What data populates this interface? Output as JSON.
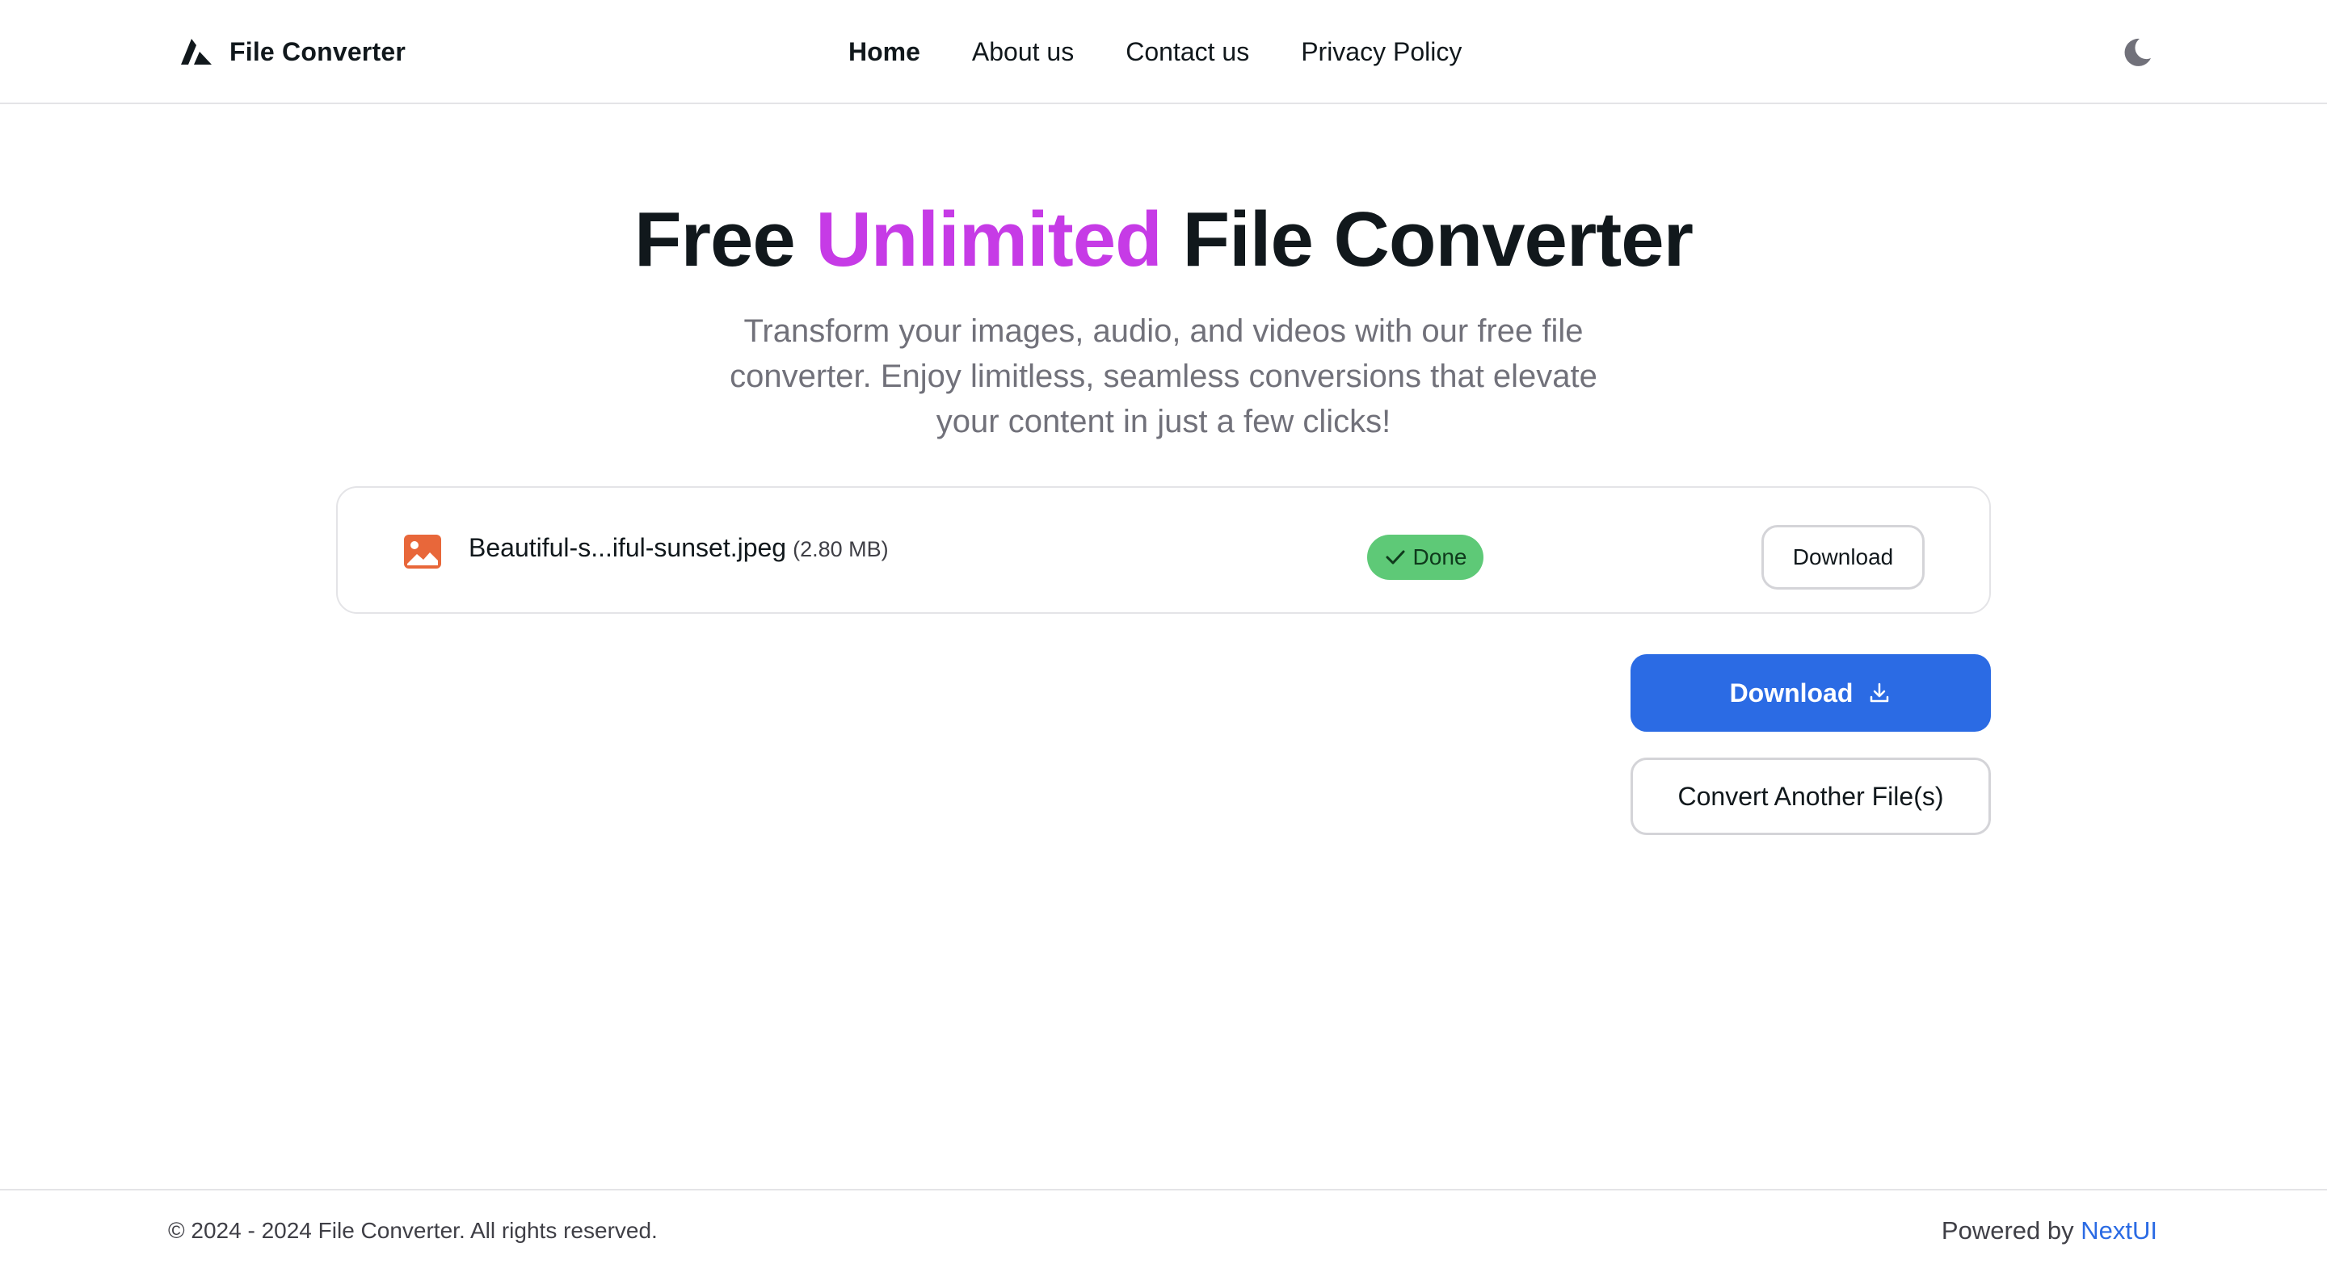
{
  "navbar": {
    "brand": {
      "name": "File Converter",
      "logo_icon": "triangle-logo-icon"
    },
    "links": [
      {
        "label": "Home",
        "active": true
      },
      {
        "label": "About us",
        "active": false
      },
      {
        "label": "Contact us",
        "active": false
      },
      {
        "label": "Privacy Policy",
        "active": false
      }
    ],
    "theme_toggle_icon": "moon-icon"
  },
  "hero": {
    "title_prefix": "Free",
    "title_accent": "Unlimited",
    "title_suffix": "File Converter",
    "subtitle": "Transform your images, audio, and videos with our free file converter. Enjoy limitless, seamless conversions that elevate your content in just a few clicks!"
  },
  "file": {
    "icon": "image-file-icon",
    "name": "Beautiful-s...iful-sunset.jpeg",
    "size": "(2.80 MB)",
    "status": "Done",
    "status_icon": "check-icon",
    "download_label": "Download"
  },
  "actions": {
    "download_all_label": "Download",
    "download_icon": "download-icon",
    "convert_another_label": "Convert Another File(s)"
  },
  "footer": {
    "copyright": "© 2024 - 2024 File Converter. All rights reserved.",
    "powered_prefix": "Powered by",
    "powered_link": "NextUI"
  },
  "colors": {
    "accent": "#c63be6",
    "primary": "#2b6be4",
    "success": "#5ec977",
    "file_icon": "#e8673a"
  }
}
